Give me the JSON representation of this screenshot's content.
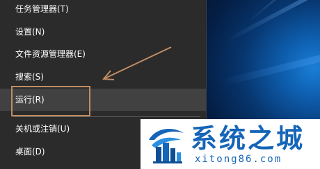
{
  "menu": {
    "items": [
      {
        "label": "任务管理器(T)"
      },
      {
        "label": "设置(N)"
      },
      {
        "label": "文件资源管理器(E)"
      },
      {
        "label": "搜索(S)"
      },
      {
        "label": "运行(R)",
        "highlighted": true
      },
      {
        "label": "关机或注销(U)"
      },
      {
        "label": "桌面(D)"
      }
    ]
  },
  "annotation": {
    "highlight_color": "#c28d63",
    "arrow_color": "#c28d63"
  },
  "watermark": {
    "title": "系统之城",
    "url": "xitong86.com",
    "color": "#1565b8"
  }
}
